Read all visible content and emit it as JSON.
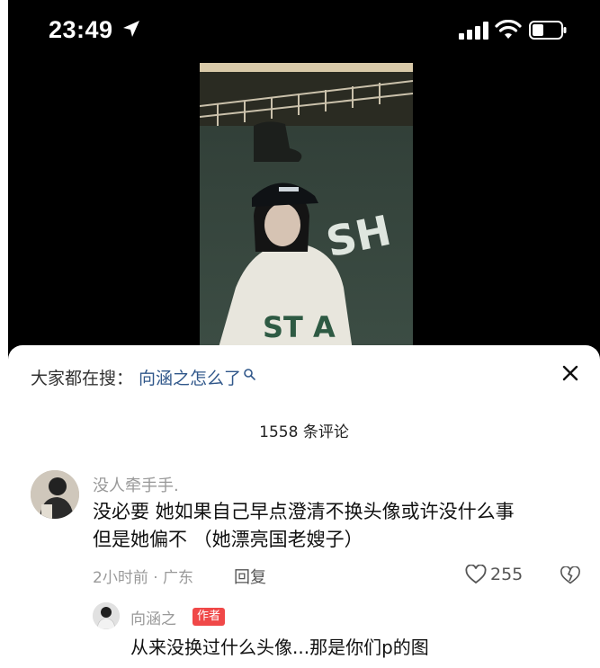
{
  "status_bar": {
    "time": "23:49"
  },
  "search_suggest": {
    "prefix": "大家都在搜：",
    "term": "向涵之怎么了"
  },
  "comments": {
    "count_label": "1558 条评论",
    "items": [
      {
        "user": "没人牵手手.",
        "text_line1": "没必要 她如果自己早点澄清不换头像或许没什么事",
        "text_line2": "但是她偏不 （她漂亮国老嫂子）",
        "meta": "2小时前 · 广东",
        "reply_label": "回复",
        "likes": "255"
      }
    ],
    "reply": {
      "user": "向涵之",
      "badge": "作者",
      "text": "从来没换过什么头像...那是你们p的图"
    }
  },
  "colors": {
    "search_term": "#30578a",
    "author_badge": "#f04848",
    "meta_text": "#9a9a9a"
  },
  "icons": [
    "location-arrow-icon",
    "signal-icon",
    "wifi-icon",
    "battery-icon",
    "search-icon",
    "close-icon",
    "heart-icon",
    "broken-heart-icon"
  ]
}
